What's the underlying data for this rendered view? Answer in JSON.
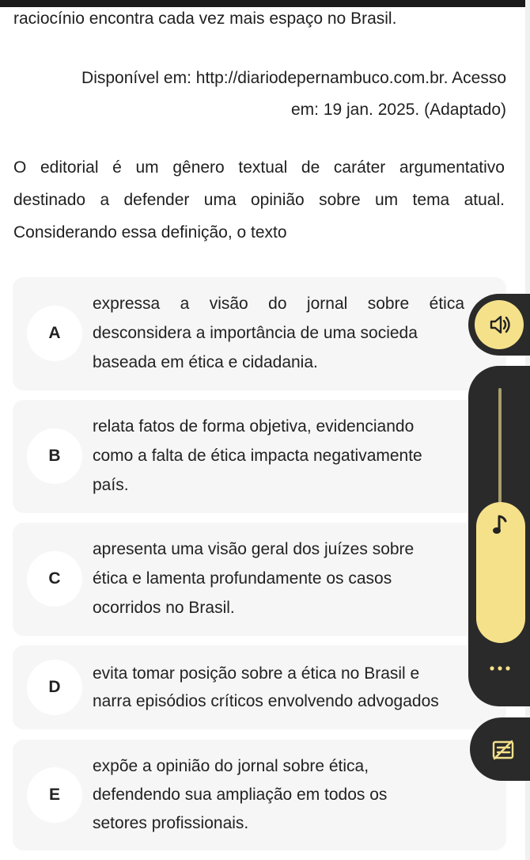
{
  "passage": {
    "last_line": "raciocínio encontra cada vez mais espaço no Brasil.",
    "source_line1": "Disponível em: http://diariodepernambuco.com.br. Acesso",
    "source_line2": "em: 19 jan. 2025. (Adaptado)"
  },
  "question": {
    "line1": "O editorial é um gênero textual de caráter argumentativo",
    "line2": "destinado a defender uma opinião sobre um tema atual.",
    "line3": "Considerando essa definição, o texto"
  },
  "options": [
    {
      "letter": "A",
      "lines": [
        "expressa a visão do jornal sobre ética",
        "desconsidera a importância de uma socieda",
        "baseada em ética e cidadania."
      ]
    },
    {
      "letter": "B",
      "lines": [
        "relata fatos de forma objetiva, evidenciando",
        "como a falta de ética impacta negativamente",
        "país."
      ]
    },
    {
      "letter": "C",
      "lines": [
        "apresenta uma visão geral dos juízes sobre",
        "ética e lamenta profundamente os casos",
        "ocorridos no Brasil."
      ]
    },
    {
      "letter": "D",
      "lines": [
        "evita tomar posição sobre a ética no Brasil e",
        "narra episódios críticos envolvendo advogados"
      ]
    },
    {
      "letter": "E",
      "lines": [
        "expõe a opinião do jornal sobre ética,",
        "defendendo sua ampliação em todos os",
        "setores profissionais."
      ]
    }
  ],
  "controls": {
    "accent_color": "#f5e18a",
    "dark_color": "#2a2a2a",
    "icons": [
      "speaker-icon",
      "music-note-icon",
      "more-icon",
      "subtitles-icon"
    ]
  }
}
